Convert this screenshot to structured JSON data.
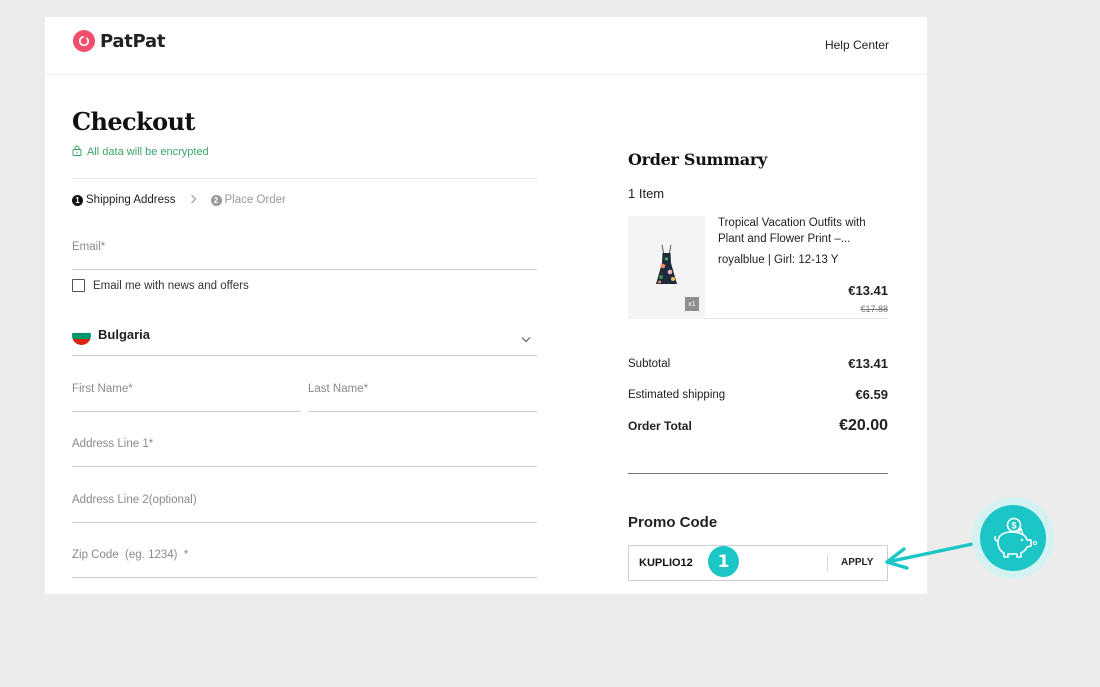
{
  "header": {
    "logo_text": "PatPat",
    "help_link": "Help Center"
  },
  "checkout": {
    "title": "Checkout",
    "secure_note": "All data will be encrypted",
    "steps": [
      {
        "number": "1",
        "label": "Shipping Address"
      },
      {
        "number": "2",
        "label": "Place Order"
      }
    ],
    "email_placeholder": "Email*",
    "newsletter_label": "Email me with news and offers",
    "country": "Bulgaria",
    "first_name_placeholder": "First Name*",
    "last_name_placeholder": "Last Name*",
    "address1_placeholder": "Address Line 1*",
    "address2_placeholder": "Address Line 2(optional)",
    "zip_placeholder": "Zip Code  (eg. 1234)  *"
  },
  "summary": {
    "title": "Order Summary",
    "items_count": "1 Item",
    "item": {
      "name": "Tropical Vacation Outfits with Plant and Flower Print –...",
      "variant": "royalblue | Girl: 12-13 Y",
      "quantity": "x1",
      "price": "€13.41",
      "old_price": "€17.88"
    },
    "subtotal_label": "Subtotal",
    "subtotal_value": "€13.41",
    "shipping_label": "Estimated shipping",
    "shipping_value": "€6.59",
    "total_label": "Order Total",
    "total_value": "€20.00",
    "promo_title": "Promo Code",
    "promo_code": "KUPLIO12",
    "apply_label": "APPLY"
  },
  "overlay": {
    "badge_number": "1"
  },
  "colors": {
    "brand": "#f0506e",
    "secure_green": "#3aa56b",
    "accent_teal": "#1cc6c6",
    "flag_white": "#ffffff",
    "flag_green": "#00966e",
    "flag_red": "#d62612"
  },
  "icons": [
    "patpat-logo-icon",
    "lock-icon",
    "chevron-right-icon",
    "chevron-down-icon",
    "bulgaria-flag-icon",
    "arrow-left-icon",
    "piggy-bank-icon"
  ]
}
